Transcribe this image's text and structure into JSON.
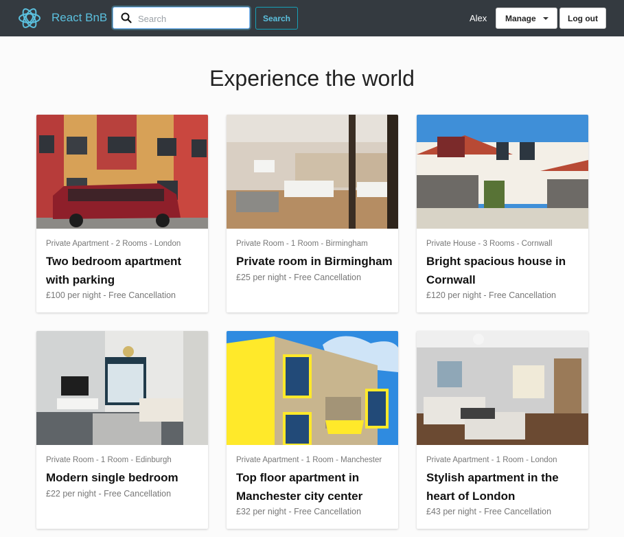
{
  "header": {
    "brand": "React BnB",
    "search": {
      "placeholder": "Search",
      "button": "Search"
    },
    "user": "Alex",
    "manage": "Manage",
    "logout": "Log out"
  },
  "page": {
    "title": "Experience the world"
  },
  "listings": [
    {
      "meta": "Private Apartment - 2 Rooms - London",
      "title": "Two bedroom apartment with parking",
      "price": "£100 per night - Free Cancellation"
    },
    {
      "meta": "Private Room - 1 Room - Birmingham",
      "title": "Private room in Birmingham",
      "price": "£25 per night - Free Cancellation"
    },
    {
      "meta": "Private House - 3 Rooms - Cornwall",
      "title": "Bright spacious house in Cornwall",
      "price": "£120 per night - Free Cancellation"
    },
    {
      "meta": "Private Room - 1 Room - Edinburgh",
      "title": "Modern single bedroom",
      "price": "£22 per night - Free Cancellation"
    },
    {
      "meta": "Private Apartment - 1 Room - Manchester",
      "title": "Top floor apartment in Manchester city center",
      "price": "£32 per night - Free Cancellation"
    },
    {
      "meta": "Private Apartment - 1 Room - London",
      "title": "Stylish apartment in the heart of London",
      "price": "£43 per night - Free Cancellation"
    }
  ]
}
